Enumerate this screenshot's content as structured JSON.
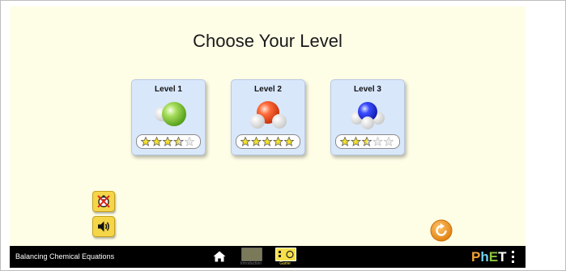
{
  "title": "Choose Your Level",
  "levels": [
    {
      "label": "Level 1",
      "stars": 3.5,
      "max_stars": 5,
      "molecule": "green-diatomic"
    },
    {
      "label": "Level 2",
      "stars": 5,
      "max_stars": 5,
      "molecule": "water-bent"
    },
    {
      "label": "Level 3",
      "stars": 2.5,
      "max_stars": 5,
      "molecule": "ammonia"
    }
  ],
  "controls": {
    "timer_toggle_icon": "timer-off-icon",
    "sound_toggle_icon": "speaker-on-icon",
    "reset_icon": "reset-icon"
  },
  "navbar": {
    "sim_title": "Balancing Chemical Equations",
    "home_icon": "home-icon",
    "screens": [
      {
        "label": "Introduction",
        "selected": false
      },
      {
        "label": "Game",
        "selected": true
      }
    ],
    "logo": "PhET",
    "menu_icon": "menu-icon"
  },
  "colors": {
    "background": "#fefde6",
    "card": "#d9e7fb",
    "star": "#f4e02c",
    "button": "#f5d649",
    "reset": "#f29b1f",
    "navbar": "#000000"
  }
}
